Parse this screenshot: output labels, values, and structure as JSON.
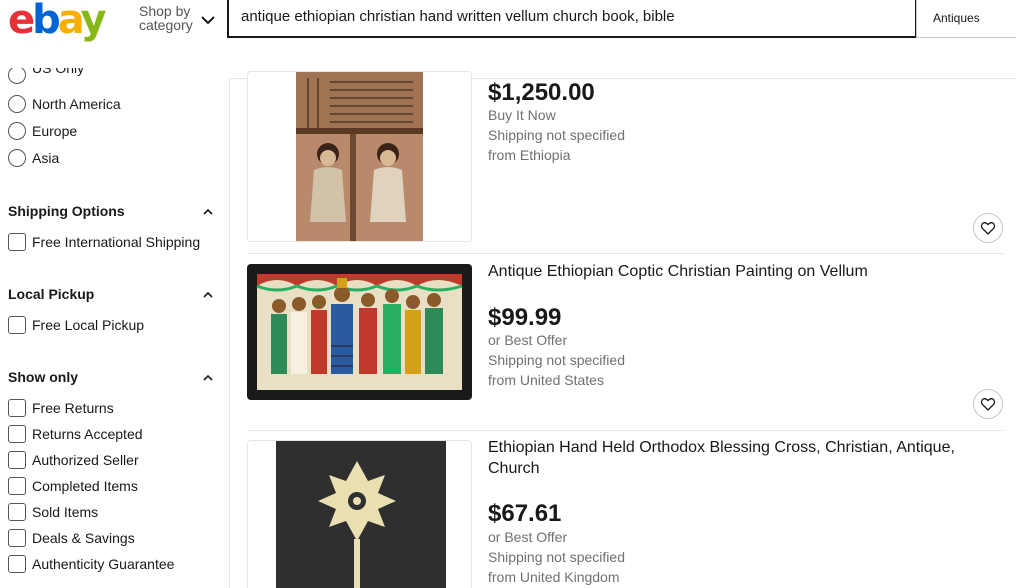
{
  "header": {
    "logo_letters": [
      "e",
      "b",
      "a",
      "y"
    ],
    "shop_by_line1": "Shop by",
    "shop_by_line2": "category",
    "search_value": "antique ethiopian christian hand written vellum church book, bible",
    "category_select": "Antiques"
  },
  "sidebar": {
    "region_partial": "US Only",
    "regions": [
      "North America",
      "Europe",
      "Asia"
    ],
    "shipping_title": "Shipping Options",
    "shipping_items": [
      "Free International Shipping"
    ],
    "pickup_title": "Local Pickup",
    "pickup_items": [
      "Free Local Pickup"
    ],
    "showonly_title": "Show only",
    "showonly_items": [
      "Free Returns",
      "Returns Accepted",
      "Authorized Seller",
      "Completed Items",
      "Sold Items",
      "Deals & Savings",
      "Authenticity Guarantee"
    ]
  },
  "results": [
    {
      "title": "",
      "price": "$1,250.00",
      "line1": "Buy It Now",
      "line2": "Shipping not specified",
      "line3": "from Ethiopia"
    },
    {
      "title": "Antique Ethiopian Coptic Christian Painting on Vellum",
      "price": "$99.99",
      "line1": "or Best Offer",
      "line2": "Shipping not specified",
      "line3": "from United States"
    },
    {
      "title": "Ethiopian Hand Held Orthodox Blessing Cross, Christian, Antique, Church",
      "price": "$67.61",
      "line1": "or Best Offer",
      "line2": "Shipping not specified",
      "line3": "from United Kingdom"
    }
  ],
  "icons": {
    "heart": "heart-icon",
    "chevron_up": "chevron-up-icon",
    "chevron_down": "chevron-down-icon"
  },
  "colors": {
    "logo_e": "#e53238",
    "logo_b": "#0064d2",
    "logo_a": "#f5af02",
    "logo_y": "#86b817"
  }
}
